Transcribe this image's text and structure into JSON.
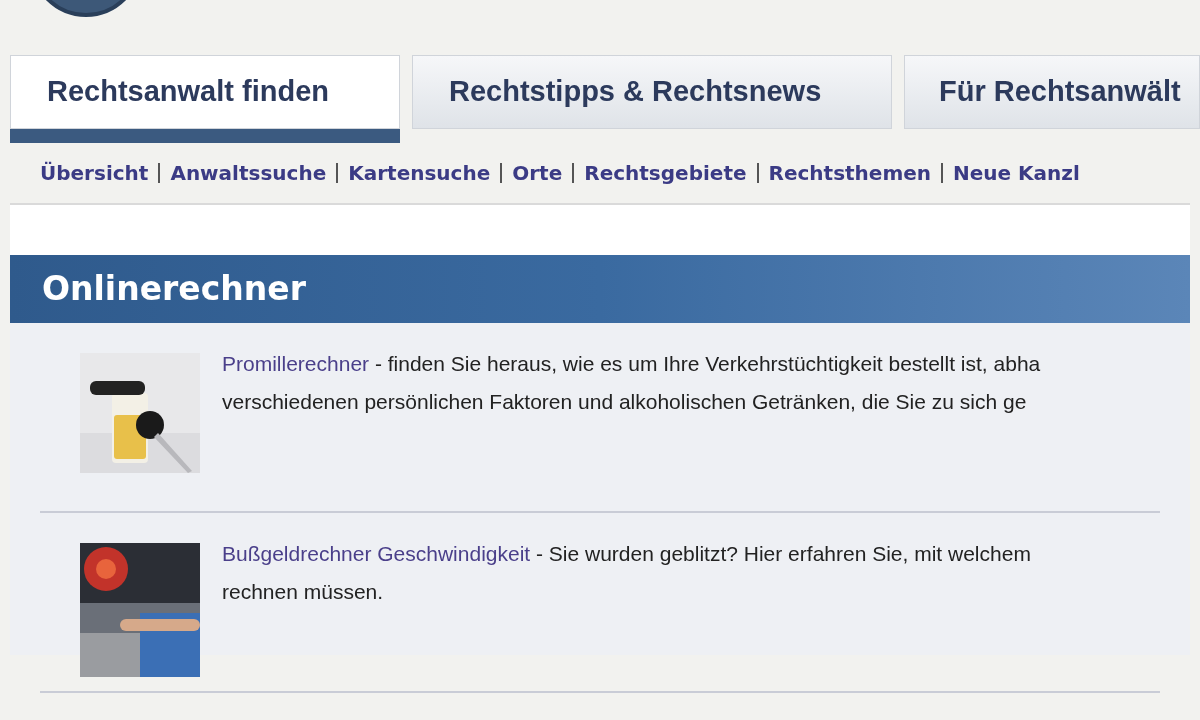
{
  "tabs": [
    {
      "label": "Rechtsanwalt finden",
      "selected": true
    },
    {
      "label": "Rechtstipps & Rechtsnews",
      "selected": false
    },
    {
      "label": "Für Rechtsanwält",
      "selected": false
    }
  ],
  "subnav": [
    "Übersicht",
    "Anwaltssuche",
    "Kartensuche",
    "Orte",
    "Rechtsgebiete",
    "Rechtsthemen",
    "Neue Kanzl"
  ],
  "section": {
    "title": "Onlinerechner",
    "items": [
      {
        "link": "Promillerechner",
        "lines": [
          " - finden Sie heraus, wie es um Ihre Verkehrstüchtigkeit bestellt ist, abha",
          "verschiedenen persönlichen Faktoren und alkoholischen Getränken, die Sie zu sich ge"
        ],
        "kind": "glass"
      },
      {
        "link": "Bußgeldrechner Geschwindigkeit",
        "lines": [
          " - Sie wurden geblitzt? Hier erfahren Sie, mit welchem",
          "rechnen müssen."
        ],
        "kind": "police"
      }
    ]
  }
}
